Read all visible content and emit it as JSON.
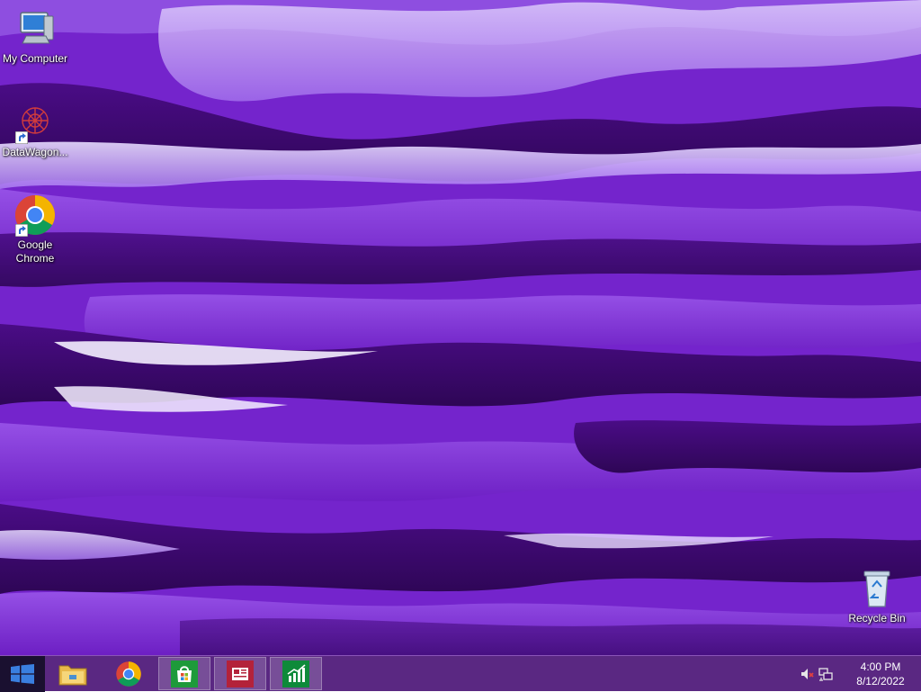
{
  "desktop": {
    "icons": [
      {
        "label": "My Computer",
        "icon": "computer-icon"
      },
      {
        "label": "DataWagon...",
        "icon": "datawagon-icon"
      },
      {
        "label": "Google Chrome",
        "icon": "chrome-icon"
      },
      {
        "label": "Recycle Bin",
        "icon": "recycle-bin-icon"
      }
    ]
  },
  "taskbar": {
    "start_icon": "windows-logo-icon",
    "pinned": [
      {
        "name": "File Explorer",
        "icon": "folder-icon",
        "active": false
      },
      {
        "name": "Google Chrome",
        "icon": "chrome-icon",
        "active": false
      },
      {
        "name": "Store",
        "icon": "store-icon",
        "active": true
      },
      {
        "name": "News",
        "icon": "news-icon",
        "active": true
      },
      {
        "name": "Finance",
        "icon": "finance-icon",
        "active": true
      }
    ],
    "tray": {
      "volume_icon": "volume-muted-icon",
      "network_icon": "network-icon",
      "time": "4:00 PM",
      "date": "8/12/2022"
    }
  },
  "colors": {
    "wallpaper_base": "#7d2bd6",
    "taskbar": "#4e1878",
    "start_button": "#1a1030"
  }
}
